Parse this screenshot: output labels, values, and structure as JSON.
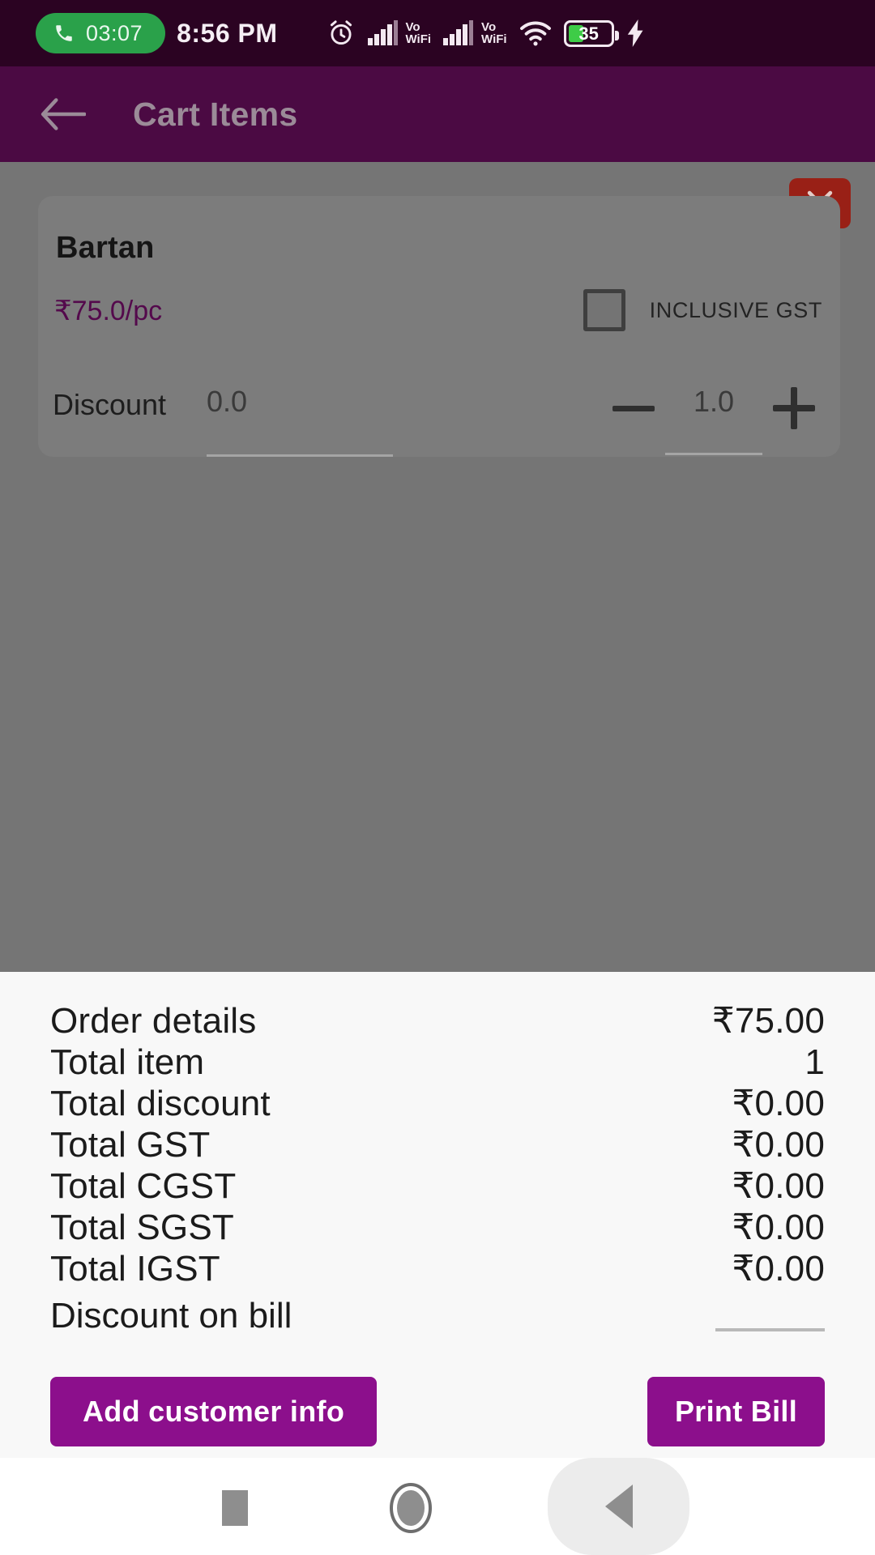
{
  "status_bar": {
    "call_timer": "03:07",
    "clock": "8:56 PM",
    "icons": [
      "phone-icon",
      "alarm-icon",
      "signal-icon",
      "vowifi-icon",
      "signal-icon",
      "vowifi-icon",
      "wifi-icon",
      "battery-icon",
      "charging-bolt-icon"
    ],
    "vowifi_top": "Vo",
    "vowifi_bottom": "WiFi",
    "battery_percent": "35",
    "colors": {
      "pill": "#2aa14a",
      "battery_fill": "#3ecc47",
      "bar_bg": "#2b0322"
    }
  },
  "app_bar": {
    "title": "Cart Items",
    "back_icon": "back-arrow-icon",
    "bg_color": "#4b0a43",
    "title_color": "#9b8b98"
  },
  "cart": {
    "close_label": "×",
    "item": {
      "name": "Bartan",
      "price": "₹75.0/pc",
      "gst_label": "INCLUSIVE GST",
      "gst_checked": false,
      "discount_label": "Discount",
      "discount_value": "0.0",
      "minus_label": "−",
      "quantity_value": "1.0",
      "plus_label": "+"
    },
    "price_color": "#54094c"
  },
  "order_details": {
    "rows": [
      {
        "label": "Order details",
        "value": "₹75.00"
      },
      {
        "label": "Total item",
        "value": "1"
      },
      {
        "label": "Total discount",
        "value": "₹0.00"
      },
      {
        "label": "Total GST",
        "value": "₹0.00"
      },
      {
        "label": "Total CGST",
        "value": "₹0.00"
      },
      {
        "label": "Total SGST",
        "value": "₹0.00"
      },
      {
        "label": "Total IGST",
        "value": "₹0.00"
      }
    ],
    "discount_on_bill_label": "Discount on bill",
    "discount_on_bill_value": ""
  },
  "actions": {
    "add_customer_info": "Add customer info",
    "print_bill": "Print Bill",
    "button_color": "#8c0f8c"
  },
  "nav_bar": {
    "recents": "recents-icon",
    "home": "home-icon",
    "back": "back-icon"
  }
}
